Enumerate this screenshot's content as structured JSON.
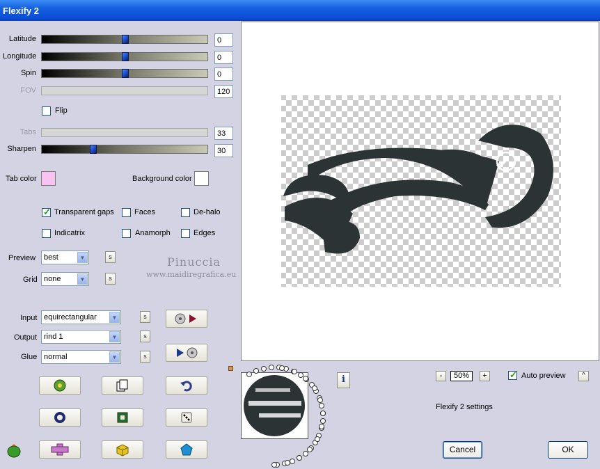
{
  "window": {
    "title": "Flexify 2"
  },
  "sliders": [
    {
      "label": "Latitude",
      "value": "0",
      "level": 0.5,
      "enabled": true
    },
    {
      "label": "Longitude",
      "value": "0",
      "level": 0.5,
      "enabled": true
    },
    {
      "label": "Spin",
      "value": "0",
      "level": 0.5,
      "enabled": true
    },
    {
      "label": "FOV",
      "value": "120",
      "enabled": false
    },
    {
      "label": "Tabs",
      "value": "33",
      "enabled": false
    },
    {
      "label": "Sharpen",
      "value": "30",
      "level": 0.3,
      "enabled": true
    }
  ],
  "flip": {
    "label": "Flip",
    "checked": false
  },
  "colors": {
    "tab_label": "Tab color",
    "tab_color": "#f9c3f1",
    "bg_label": "Background color",
    "bg_color": "#ffffff"
  },
  "options": {
    "transparent_gaps": {
      "label": "Transparent gaps",
      "checked": true
    },
    "faces": {
      "label": "Faces",
      "checked": false
    },
    "de_halo": {
      "label": "De-halo",
      "checked": false
    },
    "indicatrix": {
      "label": "Indicatrix",
      "checked": false
    },
    "anamorph": {
      "label": "Anamorph",
      "checked": false
    },
    "edges": {
      "label": "Edges",
      "checked": false
    }
  },
  "preview_mode": {
    "label": "Preview",
    "value": "best"
  },
  "grid": {
    "label": "Grid",
    "value": "none"
  },
  "watermark": {
    "line1": "Pinuccia",
    "line2": "www.maidiregrafica.eu"
  },
  "projection": {
    "input": {
      "label": "Input",
      "value": "equirectangular"
    },
    "output": {
      "label": "Output",
      "value": "rind 1"
    },
    "glue": {
      "label": "Glue",
      "value": "normal"
    }
  },
  "small_button_glyph": "s",
  "zoom": {
    "value": "50%",
    "minus": "-",
    "plus": "+"
  },
  "auto_preview": {
    "label": "Auto preview",
    "checked": true
  },
  "settings_label": "Flexify 2 settings",
  "buttons": {
    "cancel": "Cancel",
    "ok": "OK",
    "expand": "^",
    "info": "i"
  },
  "colors_accent": {
    "title_bar": "#0a4ed8",
    "panel": "#d3d3e3",
    "shape": "#2c3335"
  }
}
